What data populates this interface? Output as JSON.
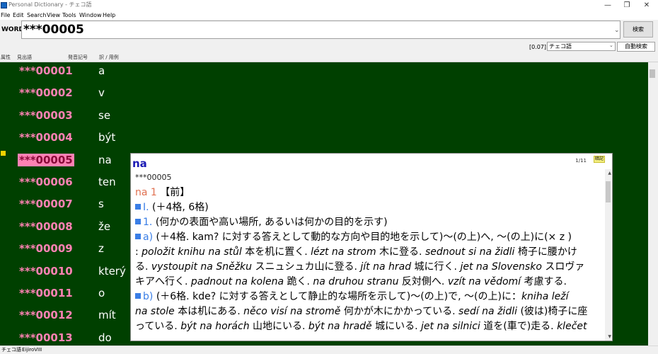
{
  "window": {
    "title": "Personal Dictionary - チェコ語",
    "controls": [
      "—",
      "❐",
      "✕"
    ]
  },
  "menu": [
    "File",
    "Edit",
    "Search",
    "View",
    "Tools",
    "Window",
    "Help"
  ],
  "wordbar": {
    "label": "WORD",
    "value": "***00005",
    "search_button": "検索"
  },
  "options": {
    "zoom": "[0.07]",
    "dictionary": "チェコ語",
    "auto_search": "自動検索"
  },
  "columns": [
    "属性",
    "見出語",
    "発音記号",
    "訳 / 用例"
  ],
  "rows": [
    {
      "code": "***00001",
      "word": "a"
    },
    {
      "code": "***00002",
      "word": "v"
    },
    {
      "code": "***00003",
      "word": "se"
    },
    {
      "code": "***00004",
      "word": "být"
    },
    {
      "code": "***00005",
      "word": "na"
    },
    {
      "code": "***00006",
      "word": "ten"
    },
    {
      "code": "***00007",
      "word": "s"
    },
    {
      "code": "***00008",
      "word": "že"
    },
    {
      "code": "***00009",
      "word": "z"
    },
    {
      "code": "***00010",
      "word": "který"
    },
    {
      "code": "***00011",
      "word": "o"
    },
    {
      "code": "***00012",
      "word": "mít"
    },
    {
      "code": "***00013",
      "word": "do"
    }
  ],
  "selected_index": 4,
  "popup": {
    "headword": "na",
    "page": "1/11",
    "tag": "暗記",
    "code": "***00005",
    "lines": [
      {
        "hw": "na 1",
        "rest": "【前】"
      },
      {
        "num": "Ⅰ.",
        "rest": "(＋4格, 6格)"
      },
      {
        "num": "1.",
        "rest": "(何かの表面や高い場所, あるいは何かの目的を示す)"
      },
      {
        "num": "a)",
        "rest": "(＋4格. kam? に対する答えとして動的な方向や目的地を示して)〜(の上)へ, 〜(の上)に(× z )"
      },
      {
        "rest1": ": ",
        "it1": "položit knihu na stůl",
        "rest2": " 本を机に置く. ",
        "it2": "lézt na strom",
        "rest3": " 木に登る. ",
        "it3": "sednout si na židli",
        "rest4": " 椅子に腰かけ"
      },
      {
        "rest1": "る. ",
        "it1": "vystoupit na Sněžku",
        "rest2": " スニュシュカ山に登る. ",
        "it2": "jít na hrad",
        "rest3": " 城に行く. ",
        "it3": "jet na Slovensko",
        "rest4": " スロヴァ"
      },
      {
        "rest1": "キアへ行く. ",
        "it1": "padnout na kolena",
        "rest2": " 跪く. ",
        "it2": "na druhou stranu",
        "rest3": " 反対側へ. ",
        "it3": "vzít na vědomí",
        "rest4": " 考慮する."
      },
      {
        "num": "b)",
        "rest": "(＋6格. kde? に対する答えとして静止的な場所を示して)〜(の上)で, 〜(の上)に：",
        "it": "kniha leží"
      },
      {
        "it1": "na stole",
        "rest2": " 本は机にある. ",
        "it2": "něco visí na stromě",
        "rest3": " 何かが木にかかっている. ",
        "it3": "sedí na židli",
        "rest4": " (彼は)椅子に座"
      },
      {
        "rest1": "っている. ",
        "it1": "být na horách",
        "rest2": " 山地にいる. ",
        "it2": "být na hradě",
        "rest3": " 城にいる. ",
        "it3": "jet na silnici",
        "rest4": " 道を(車で)走る. ",
        "it4": "klečet"
      }
    ]
  },
  "status": [
    "チェコ語",
    "EijiroVIII"
  ]
}
